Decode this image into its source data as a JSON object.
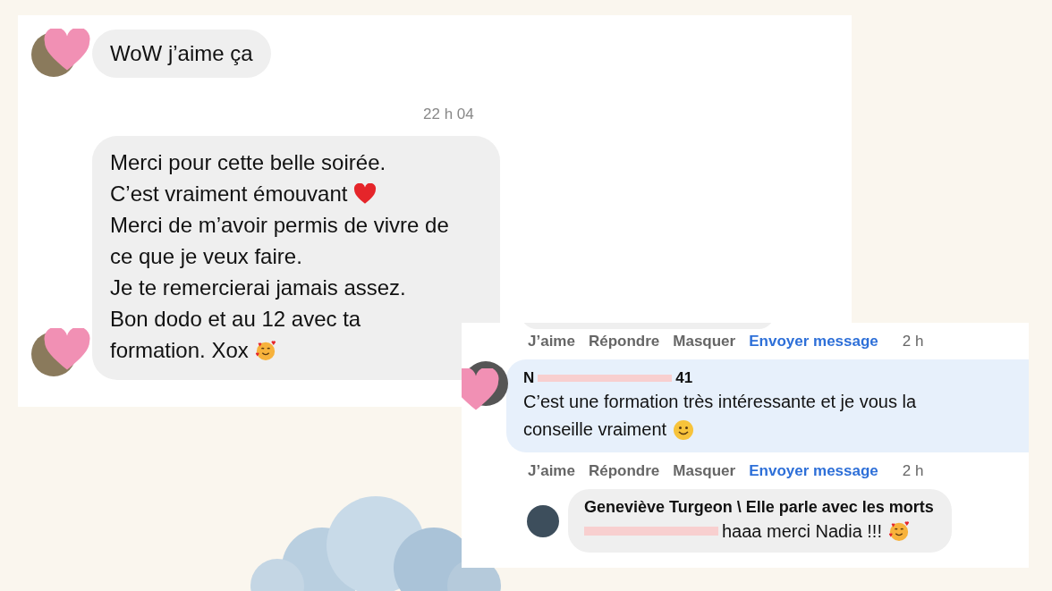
{
  "chat": {
    "messages": [
      {
        "kind": "short",
        "lines": [
          {
            "text": "WoW j’aime ça",
            "kind": "plain"
          }
        ]
      },
      {
        "kind": "time",
        "text": "22 h 04"
      },
      {
        "kind": "long",
        "lines": [
          {
            "text": "Merci pour cette belle soirée.",
            "kind": "plain"
          },
          {
            "text": "C’est vraiment émouvant",
            "kind": "heart"
          },
          {
            "text": "Merci de m’avoir permis de vivre de",
            "kind": "plain"
          },
          {
            "text": "ce que je veux faire.",
            "kind": "plain"
          },
          {
            "text": "Je te remercierai jamais assez.",
            "kind": "plain"
          },
          {
            "text": "Bon dodo et au 12 avec ta",
            "kind": "plain"
          },
          {
            "text": "formation. Xox",
            "kind": "hearts-face"
          }
        ]
      }
    ]
  },
  "comments": {
    "items": [
      {
        "kind": "actions",
        "actions": [
          {
            "label": "J’aime",
            "kind": "plain"
          },
          {
            "label": "Répondre",
            "kind": "plain"
          },
          {
            "label": "Masquer",
            "kind": "plain"
          },
          {
            "label": "Envoyer message",
            "kind": "link"
          }
        ],
        "time": "2 h"
      },
      {
        "kind": "comment",
        "author": "N",
        "author_time": "41",
        "lines": [
          {
            "text": "C’est une formation très intéressante et je vous la",
            "kind": "plain"
          },
          {
            "text": "conseille vraiment",
            "kind": "smile"
          }
        ]
      },
      {
        "kind": "actions",
        "actions": [
          {
            "label": "J’aime",
            "kind": "plain"
          },
          {
            "label": "Répondre",
            "kind": "plain"
          },
          {
            "label": "Masquer",
            "kind": "plain"
          },
          {
            "label": "Envoyer message",
            "kind": "link"
          }
        ],
        "time": "2 h"
      },
      {
        "kind": "reply",
        "author": "Geneviève Turgeon \\ Elle parle avec les morts",
        "lines": [
          {
            "text": "haaa merci Nadia !!!",
            "kind": "hearts-face"
          }
        ]
      }
    ]
  }
}
